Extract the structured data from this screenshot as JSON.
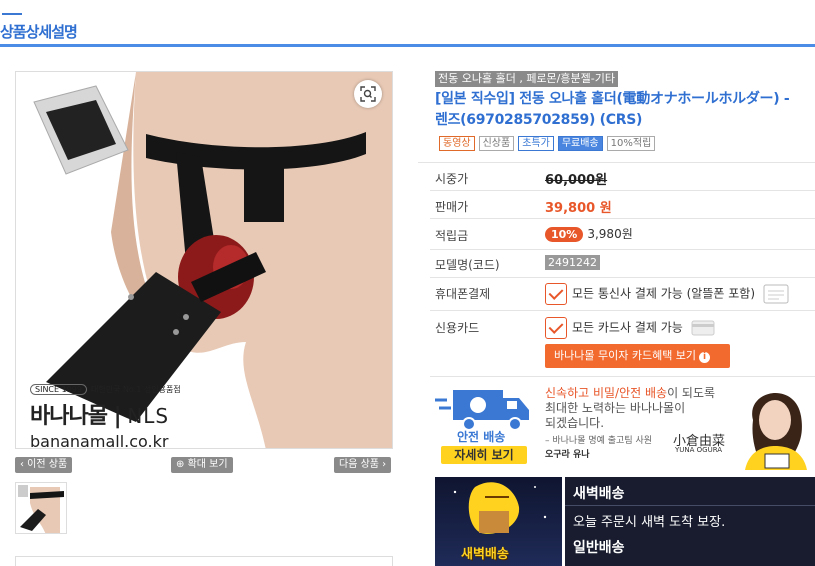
{
  "section": {
    "title": "상품상세설명"
  },
  "image": {
    "brand": {
      "since": "SINCE 1999",
      "tagline": "대한민국 No.1 성인용품점",
      "logo": "바나나몰",
      "logo_sub": "NLS",
      "site": "bananamall.co.kr"
    },
    "nav": {
      "prev": "‹ 이전 상품",
      "zoom": "확대 보기",
      "next": "다음 상품 ›"
    }
  },
  "product": {
    "category": "전동 오나홀 홀더 , 페로몬/흥분젤-기타",
    "name": "[일본 직수입] 전동 오나홀 홀더(電動オナホールホルダー) - 렌즈(6970285702859) (CRS)",
    "badges": [
      "동영상",
      "신상품",
      "초특가",
      "무료배송",
      "10%적립"
    ]
  },
  "info": {
    "list_price_label": "시중가",
    "list_price": "60,000원",
    "sale_price_label": "판매가",
    "sale_price": "39,800 원",
    "points_label": "적립금",
    "points_pct": "10%",
    "points_value": "3,980원",
    "model_label": "모델명(코드)",
    "model_value": "2491242",
    "mobile_label": "휴대폰결제",
    "mobile_text": "모든 통신사 결제 가능 (알뜰폰 포함)",
    "card_label": "신용카드",
    "card_text": "모든 카드사 결제 가능",
    "card_button": "바나나몰 무이자 카드혜택 보기"
  },
  "shipping": {
    "truck_label": "안전 배송",
    "detail_button": "자세히 보기",
    "line1_highlight": "신속하고 비밀/안전 배송",
    "line1_rest": "이 되도록",
    "line2": "최대한 노력하는 바나나몰이",
    "line3": "되겠습니다.",
    "quote": "– 바나나몰 명예 출고팀 사원",
    "quote_name": "오구라 유나",
    "signature": "小倉由菜",
    "signature_sub": "YUNA OGURA"
  },
  "dawn": {
    "label": "새벽배송",
    "title": "새벽배송",
    "desc": "오늘 주문시 새벽 도착 보장.",
    "title2": "일반배송"
  },
  "colors": {
    "accent": "#2f6fd1",
    "sale": "#e8572a",
    "yellow": "#ffd21f"
  }
}
